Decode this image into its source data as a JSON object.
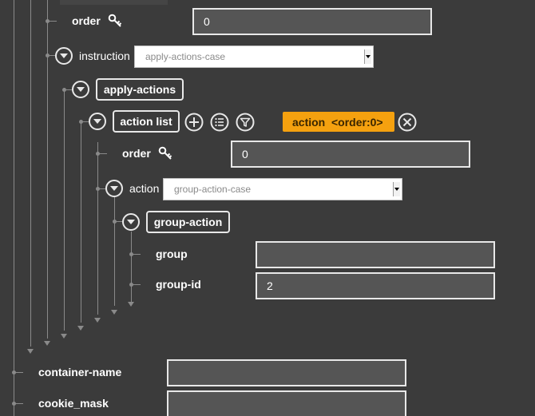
{
  "rows": {
    "order_top": {
      "label": "order",
      "value": "0"
    },
    "instruction": {
      "label": "instruction",
      "selected": "apply-actions-case"
    },
    "apply_actions": {
      "label": "apply-actions"
    },
    "action_list": {
      "label": "action list",
      "badge": "action  <order:0>"
    },
    "order_inner": {
      "label": "order",
      "value": "0"
    },
    "action": {
      "label": "action",
      "selected": "group-action-case"
    },
    "group_action": {
      "label": "group-action"
    },
    "group": {
      "label": "group",
      "value": ""
    },
    "group_id": {
      "label": "group-id",
      "value": "2"
    },
    "container_name": {
      "label": "container-name",
      "value": ""
    },
    "cookie_mask": {
      "label": "cookie_mask",
      "value": ""
    }
  },
  "icons": {
    "key": "key-icon",
    "toggle": "chevron-down-circle-icon",
    "add": "plus-circle-icon",
    "list": "list-circle-icon",
    "filter": "filter-circle-icon",
    "remove": "close-circle-icon"
  },
  "colors": {
    "background": "#3b3b3b",
    "field_background": "#555555",
    "field_border": "#e8e8e8",
    "badge": "#f5a10f",
    "tree_line": "#8a8a8a"
  }
}
